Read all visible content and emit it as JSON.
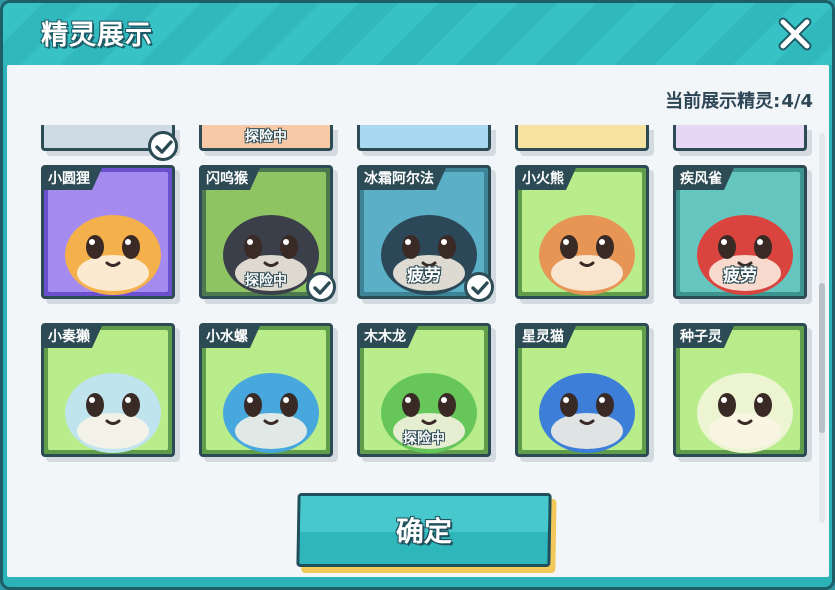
{
  "dialog": {
    "title": "精灵展示",
    "close_icon": "close-icon",
    "counter_label": "当前展示精灵:",
    "counter_value": "4/4",
    "confirm_label": "确定"
  },
  "partial_row": [
    {
      "status": "",
      "checked": true,
      "color": "#cfdbe4"
    },
    {
      "status": "探险中",
      "checked": false,
      "color": "#f8c9a6"
    },
    {
      "status": "",
      "checked": false,
      "color": "#a9d8f3"
    },
    {
      "status": "",
      "checked": false,
      "color": "#f6e3a2"
    },
    {
      "status": "",
      "checked": false,
      "color": "#e6d7f4"
    }
  ],
  "sprites": [
    {
      "name": "小圆狸",
      "status": "",
      "checked": false,
      "bg": "#a58af0",
      "body": "#f4b04a",
      "frame": "#6a4fcf"
    },
    {
      "name": "闪呜猴",
      "status": "探险中",
      "checked": true,
      "bg": "#8fc463",
      "body": "#3b3f4a",
      "frame": "#4c7a4e"
    },
    {
      "name": "冰霜阿尔法",
      "status": "疲劳",
      "checked": true,
      "bg": "#5bb0c7",
      "body": "#2c4757",
      "frame": "#3d8496"
    },
    {
      "name": "小火熊",
      "status": "",
      "checked": false,
      "bg": "#b9ec8a",
      "body": "#e69555",
      "frame": "#5f9d4a"
    },
    {
      "name": "疾风雀",
      "status": "疲劳",
      "checked": false,
      "bg": "#65c6bf",
      "body": "#d9453e",
      "frame": "#3e948f"
    },
    {
      "name": "小奏獭",
      "status": "",
      "checked": false,
      "bg": "#b9ec8a",
      "body": "#bfe4ee",
      "frame": "#5f9d4a"
    },
    {
      "name": "小水螺",
      "status": "",
      "checked": false,
      "bg": "#b9ec8a",
      "body": "#46a8dc",
      "frame": "#5f9d4a"
    },
    {
      "name": "木木龙",
      "status": "探险中",
      "checked": false,
      "bg": "#b9ec8a",
      "body": "#66c65a",
      "frame": "#5f9d4a"
    },
    {
      "name": "星灵猫",
      "status": "",
      "checked": false,
      "bg": "#b9ec8a",
      "body": "#3d7fd8",
      "frame": "#5f9d4a"
    },
    {
      "name": "种子灵",
      "status": "",
      "checked": false,
      "bg": "#b9ec8a",
      "body": "#ecf4d2",
      "frame": "#5f9d4a"
    }
  ]
}
